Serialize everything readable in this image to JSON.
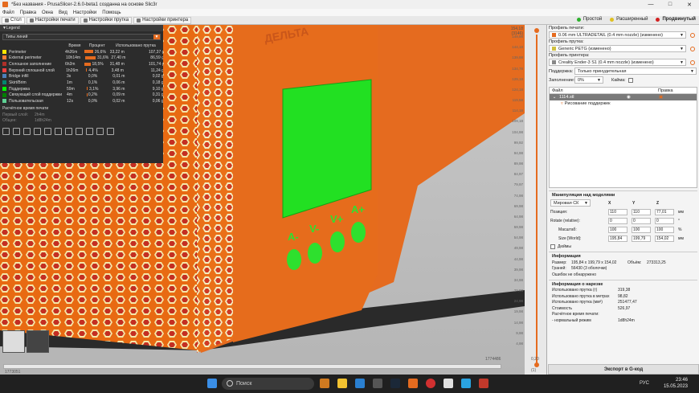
{
  "window": {
    "title": "*Без названия - PrusaSlicer-2.6.0-beta1 созданна на основе Slic3r",
    "controls": [
      "—",
      "□",
      "✕"
    ]
  },
  "menu": [
    "Файл",
    "Правка",
    "Окна",
    "Вид",
    "Настройки",
    "Помощь"
  ],
  "tabs": [
    "Стол",
    "Настройки печати",
    "Настройки прутка",
    "Настройки принтера"
  ],
  "modes": [
    {
      "label": "Простой",
      "color": "#2db02d"
    },
    {
      "label": "Расширенный",
      "color": "#e0c020"
    },
    {
      "label": "Продвинутый",
      "color": "#d22020"
    }
  ],
  "legend": {
    "title": "Legend",
    "view_type": "Типы линий",
    "columns": [
      "",
      "Время",
      "Процент",
      "Использовано прутка"
    ],
    "rows": [
      {
        "name": "Perimeter",
        "color": "#ffe600",
        "time": "4h26m",
        "pct": "26,6%",
        "pctv": 26.6,
        "used": "33,22 m",
        "weight": "107,37 g"
      },
      {
        "name": "External perimeter",
        "color": "#ff7d38",
        "time": "10h14m",
        "pct": "31,6%",
        "pctv": 31.6,
        "used": "27,40 m",
        "weight": "86,59 g"
      },
      {
        "name": "Сплошное заполнение",
        "color": "#b03029",
        "time": "6h2m",
        "pct": "18,5%",
        "pctv": 18.5,
        "used": "31,48 m",
        "weight": "101,74 g"
      },
      {
        "name": "Верхний сплошной слой",
        "color": "#f04040",
        "time": "1h26m",
        "pct": "4,4%",
        "pctv": 4.4,
        "used": "3,48 m",
        "weight": "11,24 g"
      },
      {
        "name": "Bridge infill",
        "color": "#4d80ba",
        "time": "3s",
        "pct": "0,0%",
        "pctv": 0,
        "used": "0,01 m",
        "weight": "0,02 g"
      },
      {
        "name": "Skirt/Brim",
        "color": "#00876e",
        "time": "1m",
        "pct": "0,1%",
        "pctv": 0.1,
        "used": "0,06 m",
        "weight": "0,18 g"
      },
      {
        "name": "Поддержка",
        "color": "#00ff00",
        "time": "59m",
        "pct": "3,1%",
        "pctv": 3.1,
        "used": "3,96 m",
        "weight": "9,10 g"
      },
      {
        "name": "Связующий слой поддержки",
        "color": "#008000",
        "time": "4m",
        "pct": "0,2%",
        "pctv": 0.2,
        "used": "0,09 m",
        "weight": "0,31 g"
      },
      {
        "name": "Пользовательская",
        "color": "#5ed194",
        "time": "12s",
        "pct": "0,0%",
        "pctv": 0,
        "used": "0,02 m",
        "weight": "0,06 g"
      }
    ],
    "estimate_title": "Расчётное время печати",
    "kv": [
      {
        "k": "Первый слой:",
        "v": "2h4m"
      },
      {
        "k": "Общее:",
        "v": "1d8h24m"
      }
    ]
  },
  "right": {
    "print_label": "Профиль печати:",
    "print_value": "0.06 mm ULTRADETAIL (0.4 mm nozzle) (изменено)",
    "filament_label": "Профиль прутка:",
    "filament_value": "Generic PETG (изменено)",
    "printer_label": "Профиль принтера:",
    "printer_value": "Creality Ender-3 S1 (0.4 mm nozzle) (изменено)",
    "support_label": "Поддержка:",
    "support_value": "Только принудительная",
    "infill_label": "Заполнение:",
    "infill_value": "0%",
    "brim_label": "Кайма:",
    "obj_col_file": "Файл",
    "obj_col_edit": "Правка",
    "obj_name": "1114.stl",
    "obj_child": "Рисование поддержек",
    "manip_title": "Манипуляция над моделями",
    "coord_sys": "Мировая СК",
    "axes": [
      "X",
      "Y",
      "Z"
    ],
    "position_label": "Позиция:",
    "position": [
      "110",
      "110",
      "77,01"
    ],
    "rotate_label": "Rotate (relative):",
    "rotate": [
      "0",
      "0",
      "0"
    ],
    "scale_label": "Масштаб:",
    "scale": [
      "100",
      "100",
      "100"
    ],
    "size_label": "Size [World]:",
    "size": [
      "195,84",
      "199,79",
      "154,02"
    ],
    "unit_mm": "мм",
    "unit_deg": "°",
    "unit_pct": "%",
    "inches_label": "Дюймы",
    "info_title": "Информация",
    "info": [
      {
        "k": "Размер:",
        "v": "195,84 x 199,79 x 154,02"
      },
      {
        "k": "Объём:",
        "v": "273313,25"
      },
      {
        "k": "Граней:",
        "v": "56430 (3 оболочки)"
      },
      {
        "k": "Ошибок не обнаружено",
        "v": ""
      }
    ],
    "slice_title": "Информация о нарезке",
    "slice": [
      {
        "k": "Использовано прутка (г)",
        "v": "319,38"
      },
      {
        "k": "Использовано прутка в метрах",
        "v": "98,82"
      },
      {
        "k": "Использовано прутка (мм³)",
        "v": "251477,47"
      },
      {
        "k": "Стоимость",
        "v": "526,97"
      },
      {
        "k": "Расчётное время печати:",
        "v": ""
      },
      {
        "k": "- нормальный режим",
        "v": "1d8h24m"
      }
    ],
    "export_label": "Экспорт в G-код"
  },
  "layers": {
    "top_value": "154,18",
    "top_index": "(3146)",
    "bottom_value": "0,20",
    "bottom_index": "(1)",
    "ticks": [
      "149,98",
      "144,18",
      "139,98",
      "134,78",
      "129,18",
      "124,18",
      "119,58",
      "114,18",
      "109,18",
      "104,98",
      "99,92",
      "94,98",
      "89,98",
      "84,97",
      "79,97",
      "74,98",
      "69,98",
      "64,98",
      "59,98",
      "54,98",
      "49,98",
      "44,98",
      "39,98",
      "34,98",
      "29,98",
      "24,98",
      "19,98",
      "14,98",
      "9,98",
      "4,98"
    ]
  },
  "hslider": {
    "left": "1773051",
    "right": "1774486"
  },
  "model": {
    "labels": [
      "A-",
      "V-",
      "V+",
      "A+"
    ],
    "emboss": "ДЕЛЬТА"
  },
  "taskbar": {
    "search": "Поиск",
    "lang": "РУС",
    "time": "23:46",
    "date": "15.05.2023"
  }
}
